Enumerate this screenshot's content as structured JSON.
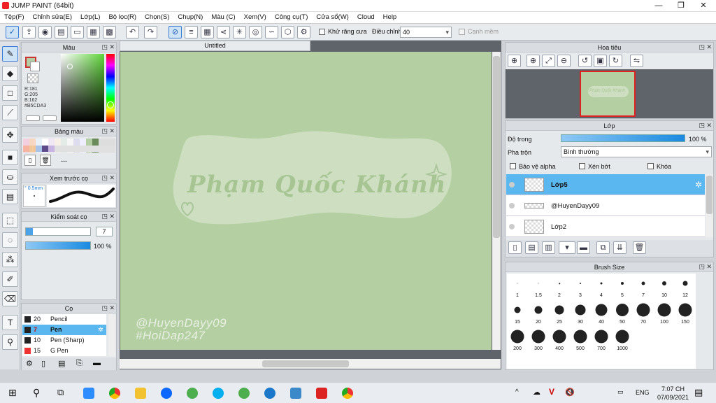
{
  "window": {
    "title": "JUMP PAINT (64bit)",
    "minimize": "—",
    "restore": "❐",
    "close": "✕"
  },
  "menu": [
    "Tệp(F)",
    "Chỉnh sửa(E)",
    "Lớp(L)",
    "Bộ lọc(R)",
    "Chọn(S)",
    "Chụp(N)",
    "Màu (C)",
    "Xem(V)",
    "Công cụ(T)",
    "Cửa sổ(W)",
    "Cloud",
    "Help"
  ],
  "toolbar": {
    "antialias_label": "Khử răng cưa",
    "adjust_label": "Điều chỉnh",
    "adjust_value": "40",
    "edge_label": "Cạnh mềm"
  },
  "color_panel": {
    "title": "Màu",
    "values": [
      "R:181",
      "G:205",
      "B:162",
      "#B5CDA3"
    ],
    "current_color": "#b5cda3"
  },
  "palette_panel": {
    "title": "Bảng màu",
    "menu": "---"
  },
  "brush_preview": {
    "title": "Xem trước cọ",
    "size": "° 0.5mm"
  },
  "brush_control": {
    "title": "Kiểm soát cọ",
    "size_value": "7",
    "opacity_value": "100 %"
  },
  "brushes": {
    "title": "Cọ",
    "items": [
      {
        "size": "20",
        "name": "Pencil",
        "color": "#222"
      },
      {
        "size": "7",
        "name": "Pen",
        "color": "#222"
      },
      {
        "size": "10",
        "name": "Pen (Sharp)",
        "color": "#222"
      },
      {
        "size": "15",
        "name": "G Pen",
        "color": "#e33"
      }
    ]
  },
  "canvas": {
    "tab": "Untitled",
    "headline": "Phạm Quốc Khánh",
    "handle": "@HuyenDayy09",
    "hashtag": "#HoiDap247"
  },
  "navigator": {
    "title": "Hoa tiêu",
    "mini_text": "Phạm Quốc Khánh"
  },
  "layers": {
    "title": "Lớp",
    "opacity_label": "Độ trong",
    "opacity_value": "100 %",
    "blend_label": "Pha trộn",
    "blend_value": "Bình thường",
    "protect_alpha": "Bảo vệ alpha",
    "clip": "Xén bớt",
    "lock": "Khóa",
    "items": [
      "Lớp5",
      "@HuyenDayy09",
      "Lớp2"
    ]
  },
  "brush_size": {
    "title": "Brush Size",
    "sizes": [
      "1",
      "1.5",
      "2",
      "3",
      "4",
      "5",
      "7",
      "10",
      "12",
      "15",
      "20",
      "25",
      "30",
      "40",
      "50",
      "70",
      "100",
      "150",
      "200",
      "300",
      "400",
      "500",
      "700",
      "1000"
    ]
  },
  "taskbar": {
    "time": "7:07 CH",
    "date": "07/09/2021",
    "lang": "ENG"
  }
}
